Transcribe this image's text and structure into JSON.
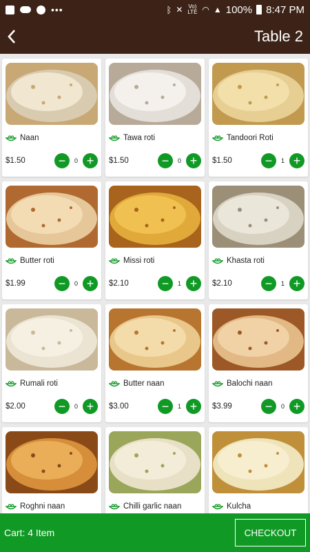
{
  "status_bar": {
    "battery": "100%",
    "time": "8:47 PM",
    "network": "Vo) LTE"
  },
  "header": {
    "title": "Table 2"
  },
  "items": [
    {
      "name": "Naan",
      "price": "$1.50",
      "qty": "0"
    },
    {
      "name": "Tawa roti",
      "price": "$1.50",
      "qty": "0"
    },
    {
      "name": "Tandoori Roti",
      "price": "$1.50",
      "qty": "1"
    },
    {
      "name": "Butter roti",
      "price": "$1.99",
      "qty": "0"
    },
    {
      "name": "Missi roti",
      "price": "$2.10",
      "qty": "1"
    },
    {
      "name": "Khasta roti",
      "price": "$2.10",
      "qty": "1"
    },
    {
      "name": "Rumali roti",
      "price": "$2.00",
      "qty": "0"
    },
    {
      "name": "Butter naan",
      "price": "$3.00",
      "qty": "1"
    },
    {
      "name": "Balochi naan",
      "price": "$3.99",
      "qty": "0"
    },
    {
      "name": "Roghni naan",
      "price": "",
      "qty": ""
    },
    {
      "name": "Chilli garlic naan",
      "price": "",
      "qty": ""
    },
    {
      "name": "Kulcha",
      "price": "",
      "qty": ""
    }
  ],
  "stepper": {
    "minus": "−",
    "plus": "+"
  },
  "footer": {
    "cart_text": "Cart: 4 Item",
    "checkout_label": "CHECKOUT"
  },
  "colors": {
    "header_bg": "#3d2317",
    "accent_green": "#109a25"
  }
}
